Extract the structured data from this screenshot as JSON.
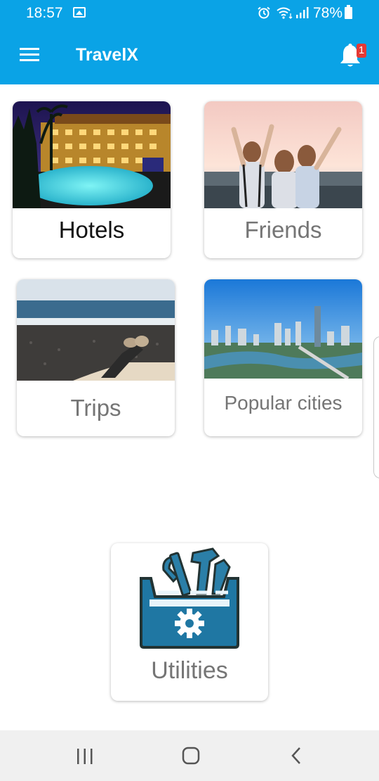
{
  "status": {
    "time": "18:57",
    "battery": "78%"
  },
  "appbar": {
    "title": "TravelX",
    "notification_count": "1"
  },
  "cards": {
    "hotels": "Hotels",
    "friends": "Friends",
    "trips": "Trips",
    "popular_cities": "Popular cities",
    "utilities": "Utilities"
  },
  "colors": {
    "primary": "#0aa3e6",
    "badge": "#e53935",
    "utility_icon": "#2b7fa8"
  }
}
